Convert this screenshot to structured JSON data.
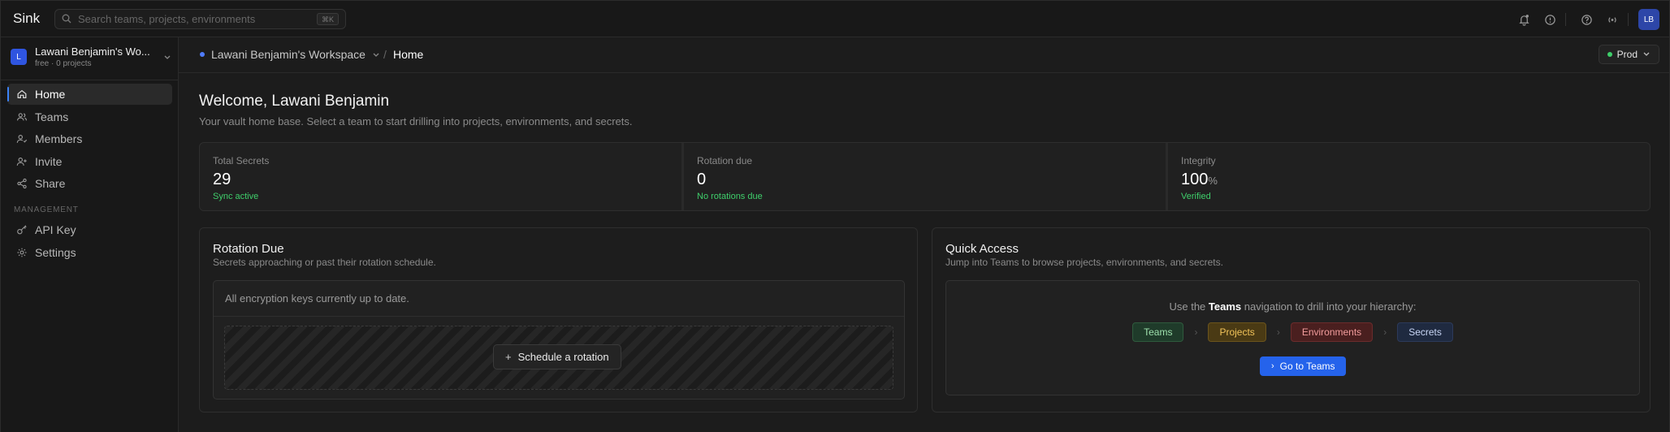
{
  "app": {
    "brand": "Sink"
  },
  "search": {
    "placeholder": "Search teams, projects, environments",
    "shortcut": "⌘K"
  },
  "topbar": {
    "icons": [
      "bell-icon",
      "alert-circle-icon",
      "help-icon",
      "broadcast-icon"
    ],
    "avatar_initials": "LB"
  },
  "sidebar": {
    "workspace_initial": "L",
    "workspace_name": "Lawani Benjamin's Wo...",
    "workspace_sub": "free · 0 projects",
    "items": [
      {
        "label": "Home",
        "icon": "home-icon",
        "active": true
      },
      {
        "label": "Teams",
        "icon": "users-icon"
      },
      {
        "label": "Members",
        "icon": "members-icon"
      },
      {
        "label": "Invite",
        "icon": "user-plus-icon"
      },
      {
        "label": "Share",
        "icon": "share-icon"
      }
    ],
    "section": "MANAGEMENT",
    "mgmt_items": [
      {
        "label": "API Key",
        "icon": "key-icon"
      },
      {
        "label": "Settings",
        "icon": "settings-icon"
      }
    ]
  },
  "breadcrumb": {
    "workspace": "Lawani Benjamin's Workspace",
    "separator": "/",
    "current": "Home"
  },
  "env": {
    "label": "Prod",
    "status_color": "#3ecf6a"
  },
  "welcome": {
    "title": "Welcome, Lawani Benjamin",
    "subtitle": "Your vault home base. Select a team to start drilling into projects, environments, and secrets."
  },
  "stats": [
    {
      "label": "Total Secrets",
      "value": "29",
      "unit": "",
      "note": "Sync active"
    },
    {
      "label": "Rotation due",
      "value": "0",
      "unit": "",
      "note": "No rotations due"
    },
    {
      "label": "Integrity",
      "value": "100",
      "unit": "%",
      "note": "Verified"
    }
  ],
  "rotation": {
    "title": "Rotation Due",
    "subtitle": "Secrets approaching or past their rotation schedule.",
    "message": "All encryption keys currently up to date.",
    "button": "Schedule a rotation"
  },
  "quick": {
    "title": "Quick Access",
    "subtitle": "Jump into Teams to browse projects, environments, and secrets.",
    "line_prefix": "Use the",
    "line_bold": "Teams",
    "line_suffix": "navigation to drill into your hierarchy:",
    "chips": [
      "Teams",
      "Projects",
      "Environments",
      "Secrets"
    ],
    "button": "Go to Teams"
  },
  "colors": {
    "accent": "#2563eb",
    "success": "#3fcf6b"
  }
}
